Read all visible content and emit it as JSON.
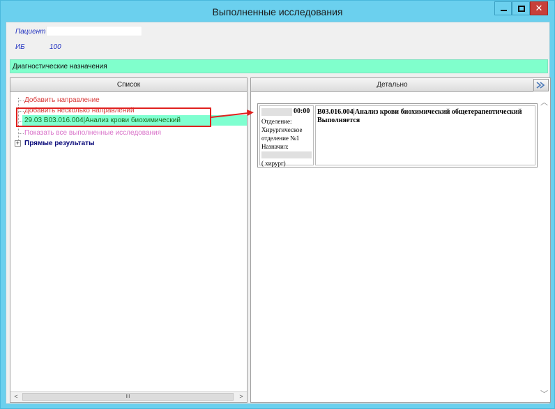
{
  "window": {
    "title": "Выполненные исследования",
    "close_glyph": "✕"
  },
  "patient": {
    "label": "Пациент",
    "value": "",
    "ib_label": "ИБ",
    "ib_value": "100"
  },
  "diagnostics_bar": {
    "label": "Диагностические назначения"
  },
  "list_panel": {
    "header": "Список",
    "items": [
      {
        "label": "Добавить направление"
      },
      {
        "label": "Добавить несколько направлений"
      },
      {
        "label": "29.03  B03.016.004|Анализ крови биохимический",
        "selected": true
      },
      {
        "label": "Показать все выполненные исследования"
      },
      {
        "label": "Прямые результаты",
        "expander": "+"
      }
    ],
    "scroll_thumb": "III"
  },
  "detail_panel": {
    "header": "Детально",
    "card": {
      "time": "00:00",
      "dept_label": "Отделение:",
      "dept_value_1": "Хирургическое",
      "dept_value_2": "отделение №1",
      "assigned_label": "Назначил:",
      "assigned_value": "(          хирург)",
      "title": "B03.016.004|Анализ крови биохимический общетерапевтический",
      "status": "Выполняется"
    }
  },
  "colors": {
    "window_frame": "#6bd0ee",
    "diag_bar": "#80ffcc",
    "selected_item": "#7fffd0",
    "annotation": "#e0201e",
    "add_link": "#d83a3a",
    "show_all_link": "#d870c8",
    "direct_results": "#0a0a7a"
  },
  "icons": {
    "minimize": "minimize-icon",
    "maximize": "maximize-icon",
    "close": "close-icon",
    "detail_action": "double-arrow-right-icon",
    "tree_expand": "plus-box-icon"
  }
}
